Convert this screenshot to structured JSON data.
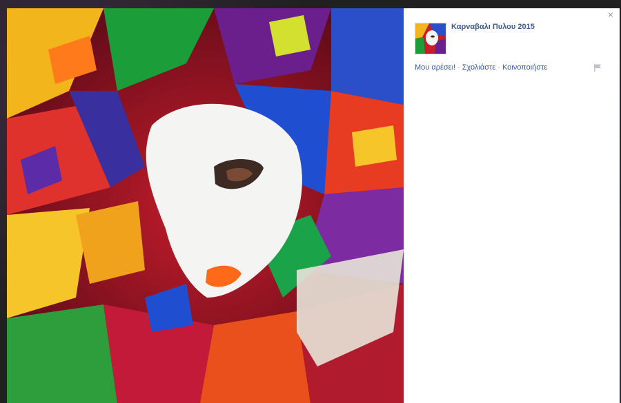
{
  "page": {
    "title": "Καρναβαλι Πυλου 2015"
  },
  "actions": {
    "like": "Μου αρέσει!",
    "comment": "Σχολιάστε",
    "share": "Κοινοποιήστε",
    "separator": "·"
  },
  "icons": {
    "close": "close-icon",
    "flag": "flag-icon"
  },
  "colors": {
    "link": "#3b5998",
    "panel": "#ffffff"
  },
  "close_glyph": "×"
}
